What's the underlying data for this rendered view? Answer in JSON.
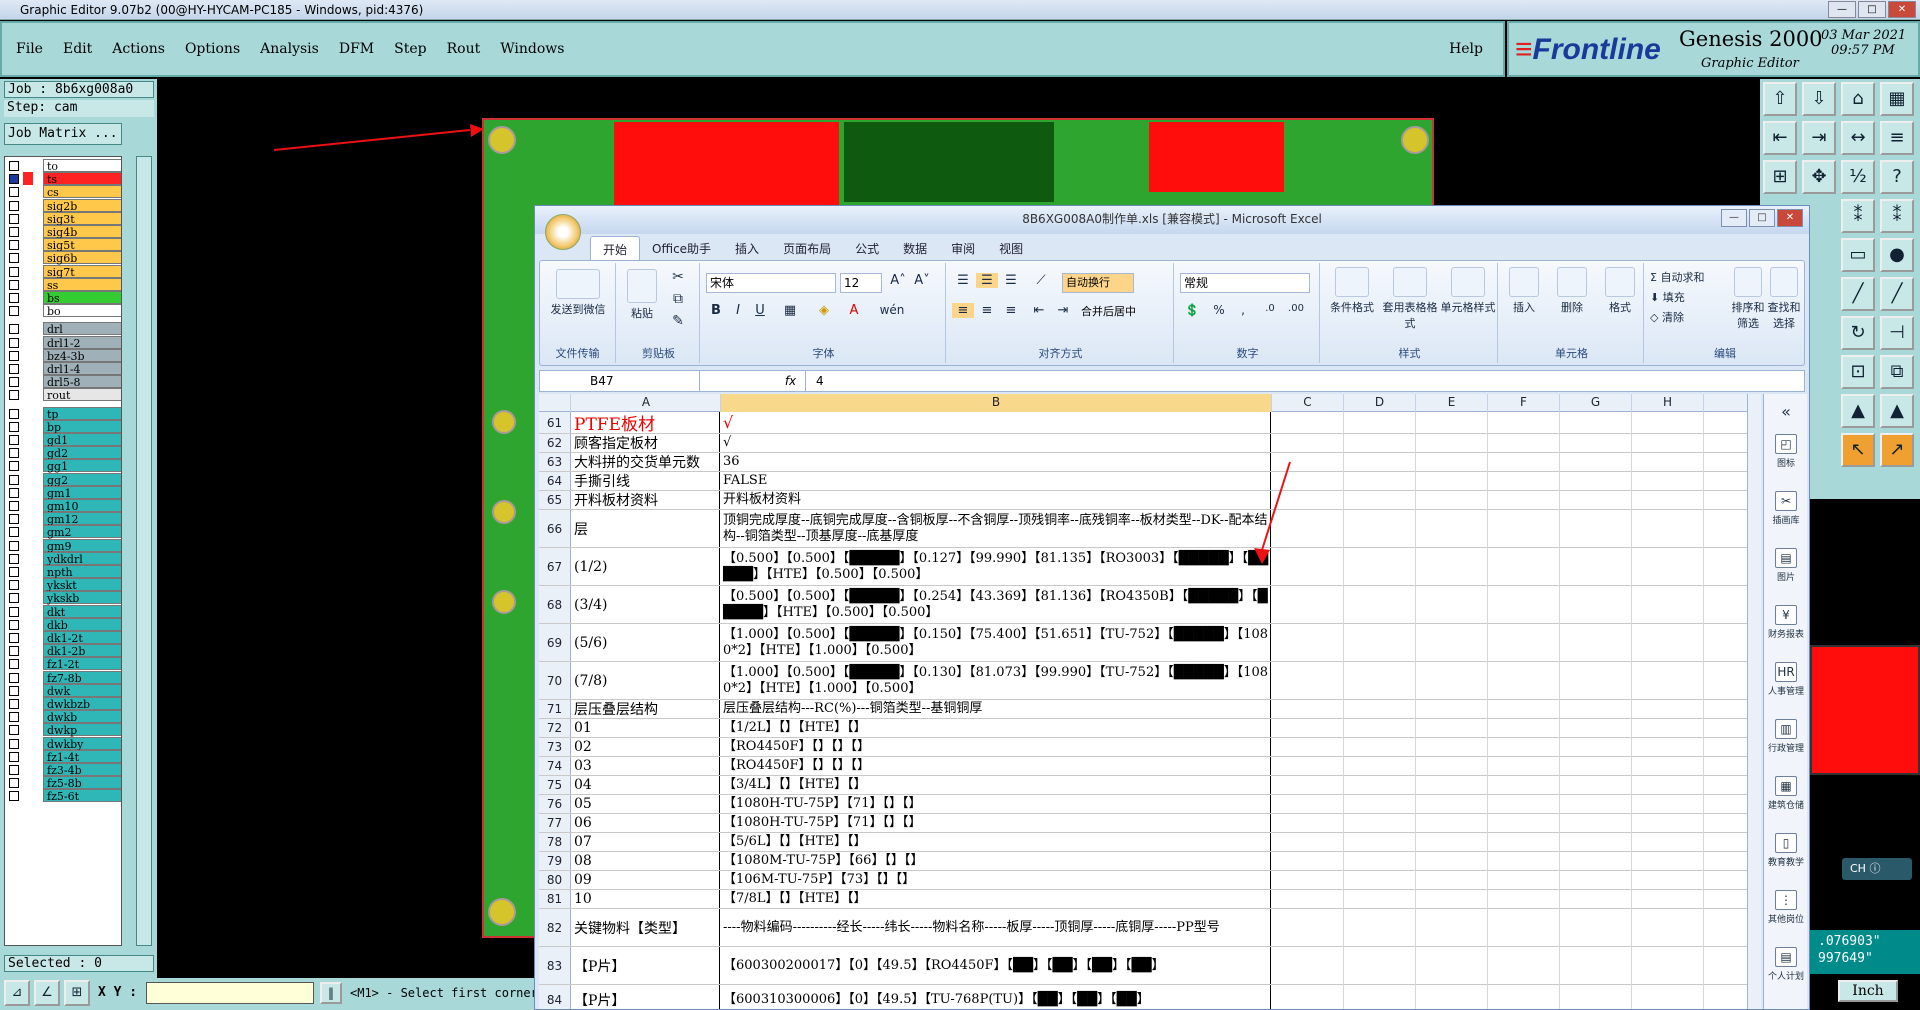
{
  "genesis": {
    "window_title": "Graphic Editor 9.07b2 (00@HY-HYCAM-PC185 - Windows, pid:4376)",
    "menus": [
      "File",
      "Edit",
      "Actions",
      "Options",
      "Analysis",
      "DFM",
      "Step",
      "Rout",
      "Windows"
    ],
    "help": "Help",
    "brand": "Frontline",
    "product": "Genesis 2000",
    "product_sub": "Graphic Editor",
    "date": "03 Mar 2021",
    "time": "09:57 PM",
    "job_label": "Job : 8b6xg008a0",
    "step_label": "Step: cam",
    "job_matrix": "Job Matrix ...",
    "selected": "Selected : 0",
    "xy_label": "X Y :",
    "status_msg": "<M1> - Select first corner",
    "coord_x": ".076903\"",
    "coord_y": "997649\"",
    "units_button": "Inch",
    "ime_label": "CH",
    "layers": [
      {
        "name": "to",
        "color": "#ffffff"
      },
      {
        "name": "ts",
        "color": "#ff2222"
      },
      {
        "name": "cs",
        "color": "#ffc84a"
      },
      {
        "name": "sig2b",
        "color": "#ffc84a"
      },
      {
        "name": "sig3t",
        "color": "#ffc84a"
      },
      {
        "name": "sig4b",
        "color": "#ffc84a"
      },
      {
        "name": "sig5t",
        "color": "#ffc84a"
      },
      {
        "name": "sig6b",
        "color": "#ffc84a"
      },
      {
        "name": "sig7t",
        "color": "#ffc84a"
      },
      {
        "name": "ss",
        "color": "#ffc84a"
      },
      {
        "name": "bs",
        "color": "#33cc33"
      },
      {
        "name": "bo",
        "color": "#ffffff"
      },
      {
        "name": "drl",
        "color": "#9fb0b8"
      },
      {
        "name": "drl1-2",
        "color": "#9fb0b8"
      },
      {
        "name": "bz4-3b",
        "color": "#9fb0b8"
      },
      {
        "name": "drl1-4",
        "color": "#9fb0b8"
      },
      {
        "name": "drl5-8",
        "color": "#9fb0b8"
      },
      {
        "name": "rout",
        "color": "#e6e6e6"
      },
      {
        "name": "tp",
        "color": "#2fb7b7"
      },
      {
        "name": "bp",
        "color": "#2fb7b7"
      },
      {
        "name": "gd1",
        "color": "#2fb7b7"
      },
      {
        "name": "gd2",
        "color": "#2fb7b7"
      },
      {
        "name": "gg1",
        "color": "#2fb7b7"
      },
      {
        "name": "gg2",
        "color": "#2fb7b7"
      },
      {
        "name": "gm1",
        "color": "#2fb7b7"
      },
      {
        "name": "gm10",
        "color": "#2fb7b7"
      },
      {
        "name": "gm12",
        "color": "#2fb7b7"
      },
      {
        "name": "gm2",
        "color": "#2fb7b7"
      },
      {
        "name": "gm9",
        "color": "#2fb7b7"
      },
      {
        "name": "ydkdrl",
        "color": "#2fb7b7"
      },
      {
        "name": "npth",
        "color": "#2fb7b7"
      },
      {
        "name": "ykskt",
        "color": "#2fb7b7"
      },
      {
        "name": "ykskb",
        "color": "#2fb7b7"
      },
      {
        "name": "dkt",
        "color": "#2fb7b7"
      },
      {
        "name": "dkb",
        "color": "#2fb7b7"
      },
      {
        "name": "dk1-2t",
        "color": "#2fb7b7"
      },
      {
        "name": "dk1-2b",
        "color": "#2fb7b7"
      },
      {
        "name": "fz1-2t",
        "color": "#2fb7b7"
      },
      {
        "name": "fz7-8b",
        "color": "#2fb7b7"
      },
      {
        "name": "dwk",
        "color": "#2fb7b7"
      },
      {
        "name": "dwkbzb",
        "color": "#2fb7b7"
      },
      {
        "name": "dwkb",
        "color": "#2fb7b7"
      },
      {
        "name": "dwkp",
        "color": "#2fb7b7"
      },
      {
        "name": "dwkby",
        "color": "#2fb7b7"
      },
      {
        "name": "fz1-4t",
        "color": "#2fb7b7"
      },
      {
        "name": "fz3-4b",
        "color": "#2fb7b7"
      },
      {
        "name": "fz5-8b",
        "color": "#2fb7b7"
      },
      {
        "name": "fz5-6t",
        "color": "#2fb7b7"
      }
    ]
  },
  "excel": {
    "title": "8B6XG008A0制作单.xls [兼容模式] - Microsoft Excel",
    "tabs": [
      "开始",
      "Office助手",
      "插入",
      "页面布局",
      "公式",
      "数据",
      "审阅",
      "视图"
    ],
    "groups": {
      "wechat": "文件传输",
      "wechat_btn": "发送到微信",
      "clipboard": "剪贴板",
      "paste": "粘贴",
      "font": "字体",
      "font_name": "宋体",
      "font_size": "12",
      "align": "对齐方式",
      "wrap": "自动换行",
      "merge": "合并后居中",
      "number": "数字",
      "number_format": "常规",
      "styles": "样式",
      "cond_format": "条件格式",
      "table_format": "套用表格格式",
      "cell_style": "单元格样式",
      "cells": "单元格",
      "insert": "插入",
      "delete": "删除",
      "format": "格式",
      "editing": "编辑",
      "autosum": "自动求和",
      "fill": "填充",
      "clear": "清除",
      "sort": "排序和筛选",
      "find": "查找和选择"
    },
    "name_box": "B47",
    "formula_value": "4",
    "columns": [
      "A",
      "B",
      "C",
      "D",
      "E",
      "F",
      "G",
      "H"
    ],
    "rows": [
      {
        "n": "61",
        "a": "PTFE板材",
        "b": "√"
      },
      {
        "n": "62",
        "a": "顾客指定板材",
        "b": "√"
      },
      {
        "n": "63",
        "a": "大料拼的交货单元数",
        "b": "36"
      },
      {
        "n": "64",
        "a": "手撕引线",
        "b": "FALSE"
      },
      {
        "n": "65",
        "a": "开料板材资料",
        "b": "开料板材资料"
      },
      {
        "n": "66",
        "a": "层",
        "b": "顶铜完成厚度--底铜完成厚度--含铜板厚--不含铜厚--顶残铜率--底残铜率--板材类型--DK--配本结构--铜箔类型--顶基厚度--底基厚度"
      },
      {
        "n": "67",
        "a": "(1/2)",
        "b": "【0.500】【0.500】【█████】【0.127】【99.990】【81.135】【RO3003】【█████】【█████】【HTE】【0.500】【0.500】"
      },
      {
        "n": "68",
        "a": "(3/4)",
        "b": "【0.500】【0.500】【█████】【0.254】【43.369】【81.136】【RO4350B】【█████】【█████】【HTE】【0.500】【0.500】"
      },
      {
        "n": "69",
        "a": "(5/6)",
        "b": "【1.000】【0.500】【█████】【0.150】【75.400】【51.651】【TU-752】【█████】【1080*2】【HTE】【1.000】【0.500】"
      },
      {
        "n": "70",
        "a": "(7/8)",
        "b": "【1.000】【0.500】【█████】【0.130】【81.073】【99.990】【TU-752】【█████】【1080*2】【HTE】【1.000】【0.500】"
      },
      {
        "n": "71",
        "a": "层压叠层结构",
        "b": "层压叠层结构---RC(%)---铜箔类型--基铜铜厚"
      },
      {
        "n": "72",
        "a": "01",
        "b": "【1/2L】【】【HTE】【】"
      },
      {
        "n": "73",
        "a": "02",
        "b": "【RO4450F】【】【】【】"
      },
      {
        "n": "74",
        "a": "03",
        "b": "【RO4450F】【】【】【】"
      },
      {
        "n": "75",
        "a": "04",
        "b": "【3/4L】【】【HTE】【】"
      },
      {
        "n": "76",
        "a": "05",
        "b": "【1080H-TU-75P】【71】【】【】"
      },
      {
        "n": "77",
        "a": "06",
        "b": "【1080H-TU-75P】【71】【】【】"
      },
      {
        "n": "78",
        "a": "07",
        "b": "【5/6L】【】【HTE】【】"
      },
      {
        "n": "79",
        "a": "08",
        "b": "【1080M-TU-75P】【66】【】【】"
      },
      {
        "n": "80",
        "a": "09",
        "b": "【106M-TU-75P】【73】【】【】"
      },
      {
        "n": "81",
        "a": "10",
        "b": "【7/8L】【】【HTE】【】"
      },
      {
        "n": "82",
        "a": "关键物料【类型】",
        "b": "----物料编码----------经长-----纬长-----物料名称-----板厚-----顶铜厚-----底铜厚-----PP型号"
      },
      {
        "n": "83",
        "a": "【P片】",
        "b": "【600300200017】【0】【49.5】【RO4450F】【██】【██】【██】【██】"
      },
      {
        "n": "84",
        "a": "【P片】",
        "b": "【600310300006】【0】【49.5】【TU-768P(TU)】【██】【██】【██】"
      }
    ],
    "sidebar": [
      "图标",
      "插画库",
      "图片",
      "财务报表",
      "人事管理",
      "行政管理",
      "建筑仓储",
      "教育教学",
      "其他岗位",
      "个人计划"
    ]
  }
}
